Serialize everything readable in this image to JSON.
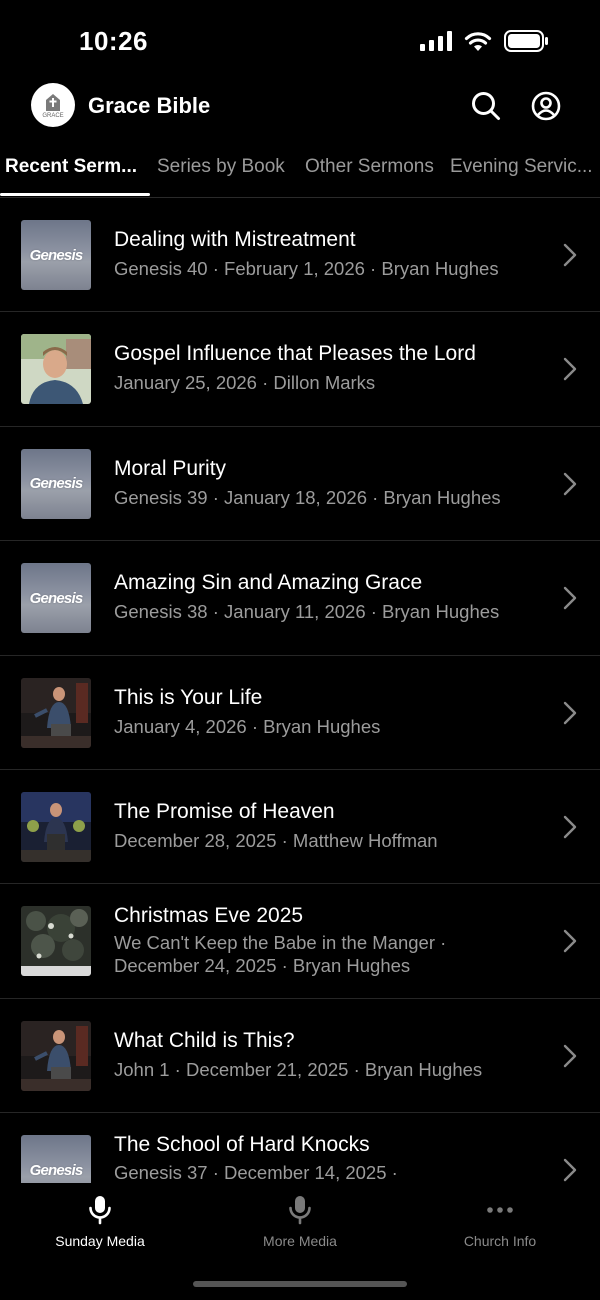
{
  "status": {
    "time": "10:26"
  },
  "header": {
    "logo_text": "GRACE",
    "title": "Grace Bible"
  },
  "tabs": [
    {
      "label": "Recent Serm..."
    },
    {
      "label": "Series by Book"
    },
    {
      "label": "Other Sermons"
    },
    {
      "label": "Evening Servic..."
    }
  ],
  "sermons": [
    {
      "title": "Dealing with Mistreatment",
      "sub": "Genesis 40 · February 1, 2026 · Bryan Hughes",
      "thumb": "genesis",
      "thumb_text": "Genesis"
    },
    {
      "title": "Gospel Influence that Pleases the Lord",
      "sub": "January 25, 2026 · Dillon Marks",
      "thumb": "portrait"
    },
    {
      "title": "Moral Purity",
      "sub": "Genesis 39 · January 18, 2026 · Bryan Hughes",
      "thumb": "genesis",
      "thumb_text": "Genesis"
    },
    {
      "title": "Amazing Sin and Amazing Grace",
      "sub": "Genesis 38 · January 11, 2026 · Bryan Hughes",
      "thumb": "genesis",
      "thumb_text": "Genesis"
    },
    {
      "title": "This is Your Life",
      "sub": "January 4, 2026 · Bryan Hughes",
      "thumb": "pulpit"
    },
    {
      "title": "The Promise of Heaven",
      "sub": "December 28, 2025 · Matthew Hoffman",
      "thumb": "pulpit2"
    },
    {
      "title": "Christmas Eve 2025",
      "sub": "We Can't Keep the Babe in the Manger ·",
      "sub2": "December 24, 2025 · Bryan Hughes",
      "thumb": "tree"
    },
    {
      "title": "What Child is This?",
      "sub": "John 1 · December 21, 2025 · Bryan Hughes",
      "thumb": "pulpit"
    },
    {
      "title": "The School of Hard Knocks",
      "sub": "Genesis 37 · December 14, 2025 ·",
      "thumb": "genesis",
      "thumb_text": "Genesis"
    }
  ],
  "bottom_nav": [
    {
      "label": "Sunday Media",
      "icon": "microphone-icon",
      "active": true
    },
    {
      "label": "More Media",
      "icon": "microphone-icon",
      "active": false
    },
    {
      "label": "Church Info",
      "icon": "more-icon",
      "active": false
    }
  ]
}
